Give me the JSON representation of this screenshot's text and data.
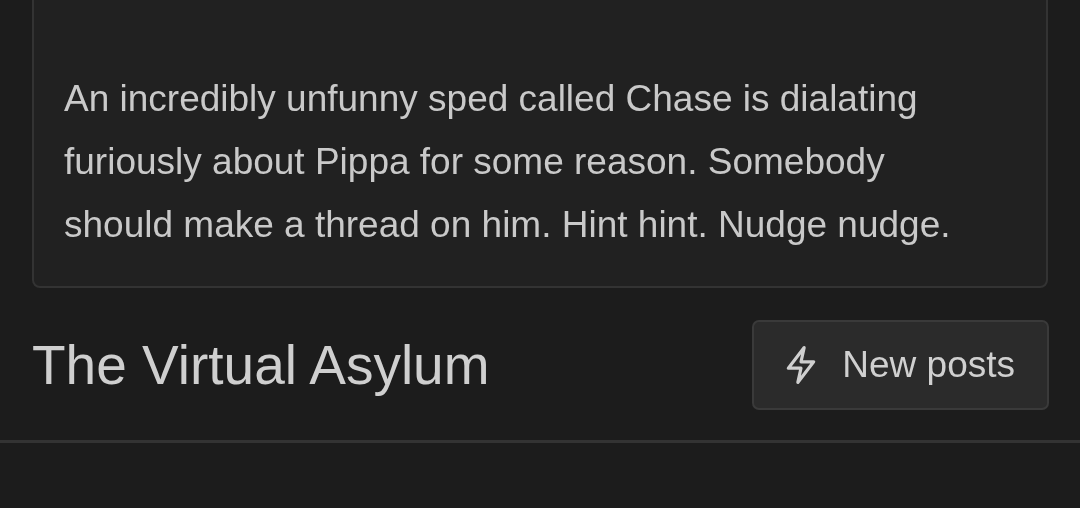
{
  "post": {
    "text": "An incredibly unfunny sped called Chase is dialating furiously about Pippa for some reason. Somebody should make a thread on him. Hint hint. Nudge nudge."
  },
  "section": {
    "title": "The Virtual Asylum",
    "button": "New posts"
  }
}
